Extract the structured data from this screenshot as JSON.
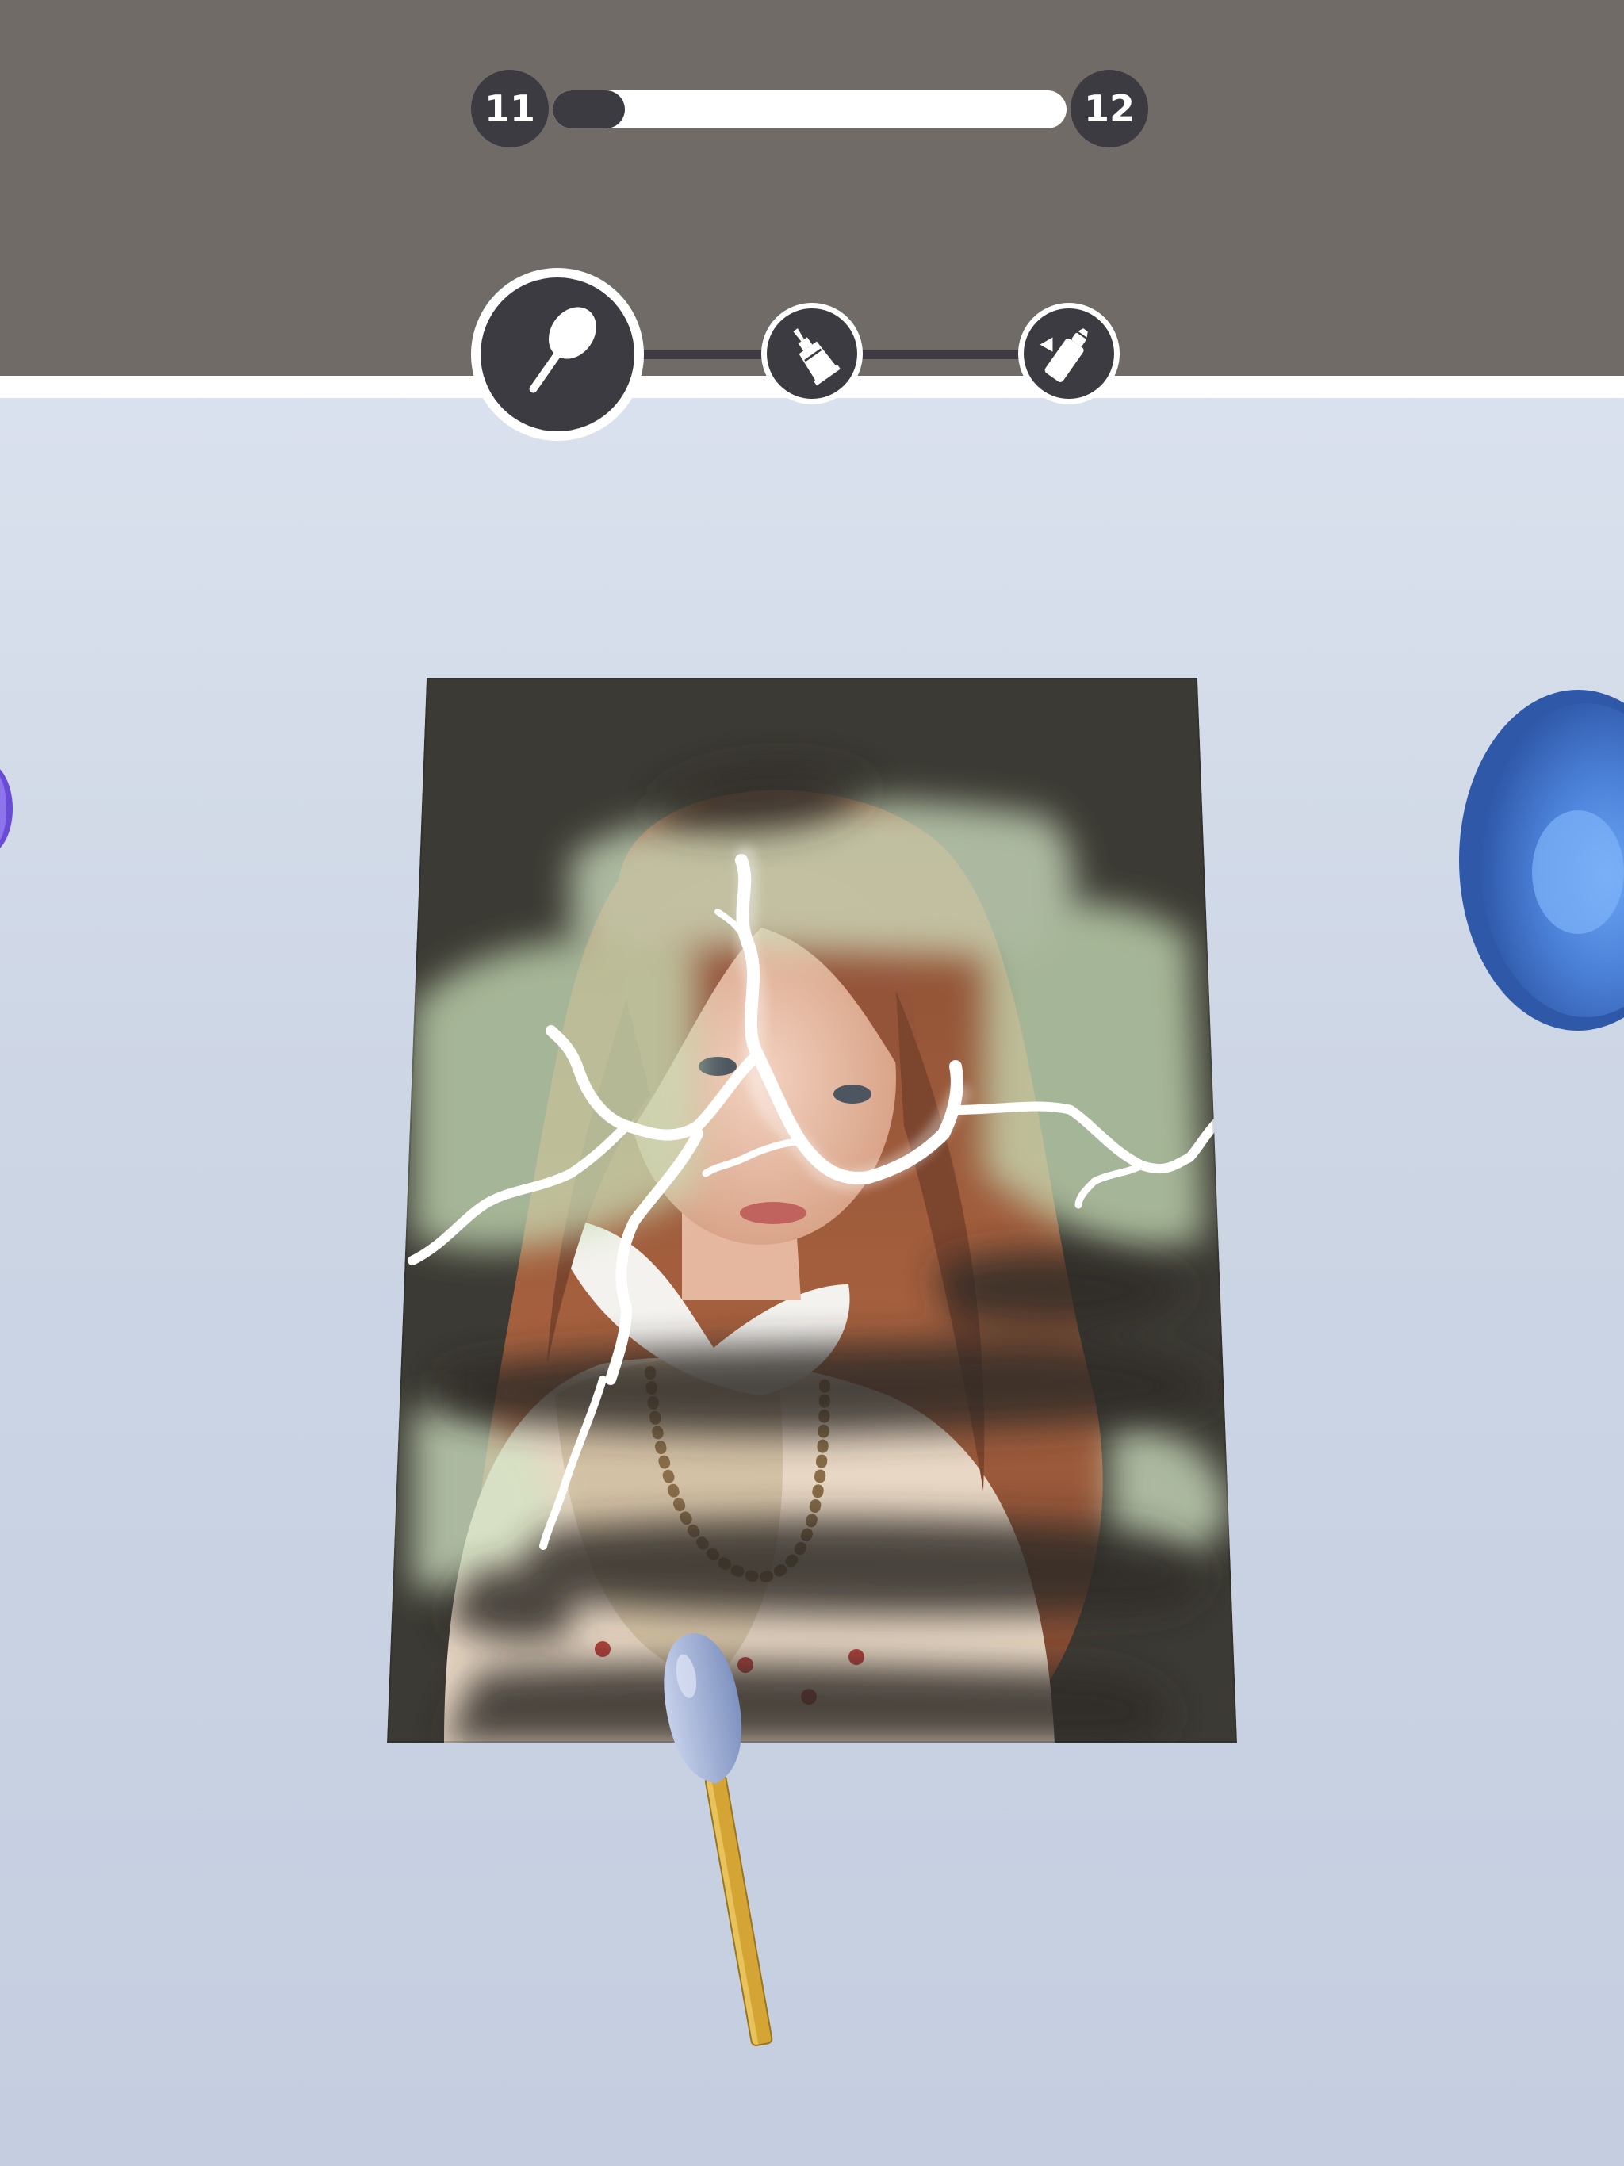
{
  "hud": {
    "level_current": "11",
    "level_next": "12",
    "level_progress": 0.14
  },
  "tools": [
    {
      "name": "spatula-icon",
      "state": "active"
    },
    {
      "name": "glue-tube-icon",
      "state": "inactive"
    },
    {
      "name": "spray-can-icon",
      "state": "inactive"
    }
  ],
  "colors": {
    "hud_band": "#706b67",
    "hud_dark": "#3c3b41",
    "table": "#cdd6e5",
    "bowl_right": "#4a7fd6",
    "bowl_left": "#6a4bd6",
    "swab_tip": "#9fb0d6",
    "swab_stick": "#d4a534"
  }
}
